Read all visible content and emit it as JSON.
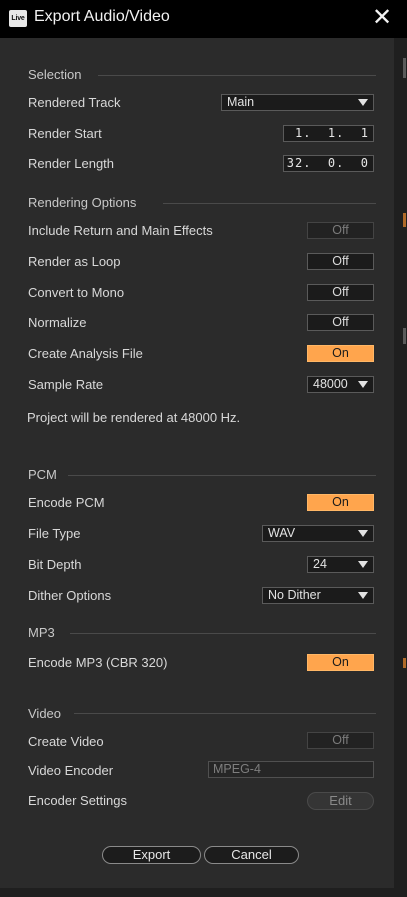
{
  "window": {
    "app_icon_text": "Live",
    "title": "Export Audio/Video",
    "close_glyph": "✕"
  },
  "sections": {
    "selection": "Selection",
    "rendering_options": "Rendering Options",
    "pcm": "PCM",
    "mp3": "MP3",
    "video": "Video"
  },
  "selection": {
    "rendered_track_label": "Rendered Track",
    "rendered_track_value": "Main",
    "render_start_label": "Render Start",
    "render_start_value": "1.  1.  1",
    "render_length_label": "Render Length",
    "render_length_value": "32.  0.  0"
  },
  "rendering_options": {
    "include_return_label": "Include Return and Main Effects",
    "include_return_value": "Off",
    "render_loop_label": "Render as Loop",
    "render_loop_value": "Off",
    "convert_mono_label": "Convert to Mono",
    "convert_mono_value": "Off",
    "normalize_label": "Normalize",
    "normalize_value": "Off",
    "analysis_file_label": "Create Analysis File",
    "analysis_file_value": "On",
    "sample_rate_label": "Sample Rate",
    "sample_rate_value": "48000",
    "note": "Project will be rendered at 48000 Hz."
  },
  "pcm": {
    "encode_pcm_label": "Encode PCM",
    "encode_pcm_value": "On",
    "file_type_label": "File Type",
    "file_type_value": "WAV",
    "bit_depth_label": "Bit Depth",
    "bit_depth_value": "24",
    "dither_label": "Dither Options",
    "dither_value": "No Dither"
  },
  "mp3": {
    "encode_mp3_label": "Encode MP3 (CBR 320)",
    "encode_mp3_value": "On"
  },
  "video": {
    "create_video_label": "Create Video",
    "create_video_value": "Off",
    "encoder_label": "Video Encoder",
    "encoder_value": "MPEG-4",
    "settings_label": "Encoder Settings",
    "edit_label": "Edit"
  },
  "footer": {
    "export_label": "Export",
    "cancel_label": "Cancel"
  },
  "colors": {
    "accent_on": "#ffa54d",
    "background": "#2b2b2b",
    "titlebar": "#000000"
  }
}
